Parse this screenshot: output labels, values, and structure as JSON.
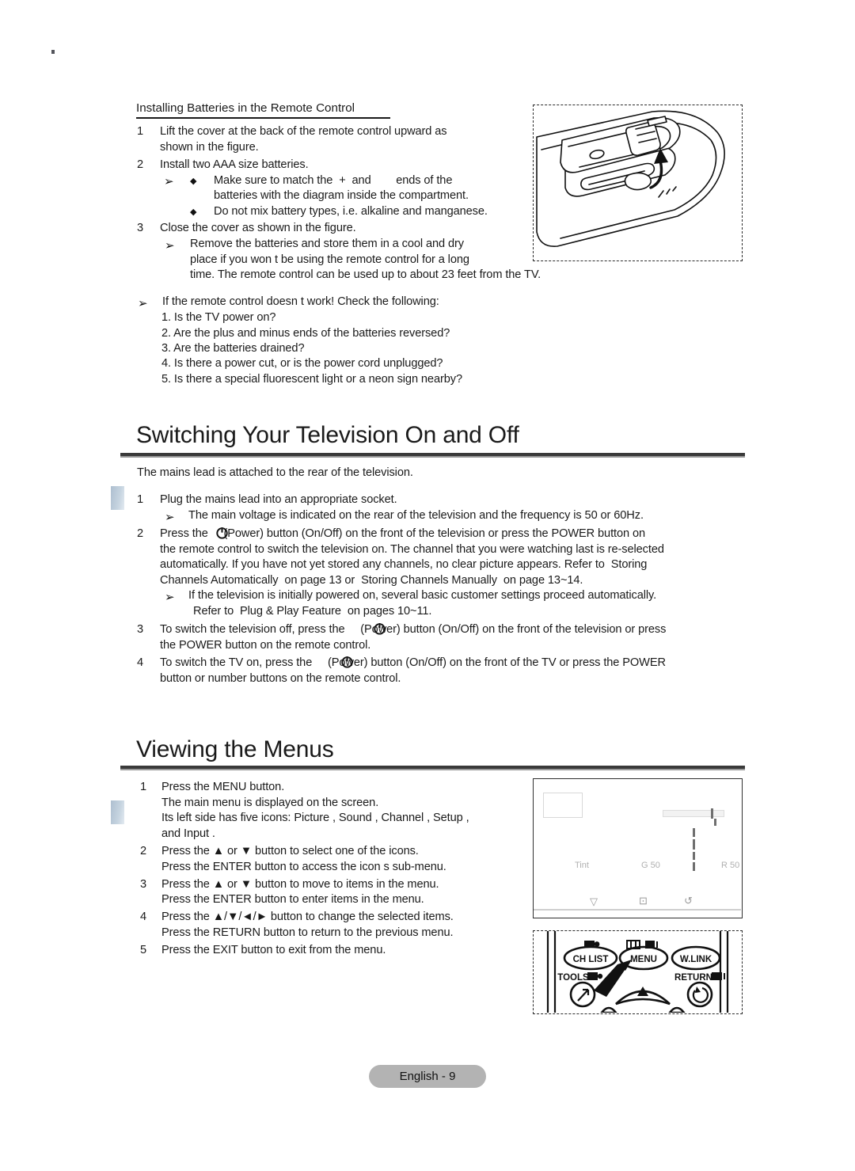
{
  "page": {
    "footer_label": "English - 9"
  },
  "battery_section": {
    "heading": "Installing Batteries in the Remote Control",
    "steps": [
      {
        "num": "1",
        "lines": [
          "Lift the cover at the back of the remote control upward as",
          "shown in the figure."
        ]
      },
      {
        "num": "2",
        "lines": [
          "Install two AAA size batteries."
        ]
      },
      {
        "num": "3",
        "lines": [
          "Close the cover as shown in the figure."
        ]
      }
    ],
    "bullet_a_line1": "Make sure to match the  +  and        ends of the",
    "bullet_a_line2": "batteries with the diagram inside the compartment.",
    "bullet_b": "Do not mix battery types, i.e. alkaline and manganese.",
    "note_lines": [
      "Remove the batteries and store them in a cool and dry",
      "place if you won t be using the remote control for a long",
      "time. The remote control can be used up to about 23 feet from the TV."
    ],
    "trouble_intro": "If the remote control doesn t work! Check the following:",
    "trouble_items": [
      "1. Is the TV power on?",
      "2. Are the plus and minus ends of the batteries reversed?",
      "3. Are the batteries drained?",
      "4. Is there a power cut, or is the power cord unplugged?",
      "5. Is there a special fluorescent light or a neon sign nearby?"
    ]
  },
  "switching_section": {
    "title": "Switching Your Television On and Off",
    "intro": "The mains lead is attached to the rear of the television.",
    "step1_num": "1",
    "step1": "Plug the mains lead into an appropriate socket.",
    "step1_note": "The main voltage is indicated on the rear of the television and the frequency is 50 or 60Hz.",
    "step2_num": "2",
    "step2_lines": [
      "Press the     (Power) button (On/Off) on the front of the television or press the POWER button on",
      "the remote control to switch the television on. The channel that you were watching last is re-selected",
      "automatically. If you have not yet stored any channels, no clear picture appears. Refer to  Storing",
      "Channels Automatically  on page 13 or  Storing Channels Manually  on page 13~14."
    ],
    "step2_note_lines": [
      "If the television is initially powered on, several basic customer settings proceed automatically.",
      "Refer to  Plug & Play Feature  on pages 10~11."
    ],
    "step3_num": "3",
    "step3_lines": [
      "To switch the television off, press the     (Power) button (On/Off) on the front of the television or press",
      "the POWER button on the remote control."
    ],
    "step4_num": "4",
    "step4_lines": [
      "To switch the TV on, press the     (Power) button (On/Off) on the front of the TV or press the POWER",
      "button or number buttons on the remote control."
    ]
  },
  "menus_section": {
    "title": "Viewing the Menus",
    "steps": [
      {
        "num": "1",
        "lines": [
          "Press the MENU button.",
          "The main menu is displayed on the screen.",
          "Its left side has five icons: Picture , Sound , Channel , Setup ,",
          "and Input ."
        ]
      },
      {
        "num": "2",
        "lines": [
          "Press the ▲ or ▼ button to select one of the icons.",
          "Press the ENTER button to access the icon s sub-menu."
        ]
      },
      {
        "num": "3",
        "lines": [
          "Press the ▲ or ▼ button to move to items in the menu.",
          "Press the ENTER button to enter items in the menu."
        ]
      },
      {
        "num": "4",
        "lines": [
          "Press the ▲/▼/◄/► button to change the selected items.",
          "Press the RETURN button to return to the previous menu."
        ]
      },
      {
        "num": "5",
        "lines": [
          "Press the EXIT button to exit from the menu."
        ]
      }
    ]
  },
  "osd_figure": {
    "label_tint": "Tint",
    "label_green": "G 50",
    "label_red": "R 50",
    "icon_move": "▽",
    "icon_enter": "⊡",
    "icon_return": "↺"
  },
  "remote_figure": {
    "buttons": [
      {
        "name": "ch-list-button",
        "label": "CH LIST"
      },
      {
        "name": "menu-button",
        "label": "MENU"
      },
      {
        "name": "w-link-button",
        "label": "W.LINK"
      }
    ],
    "tools_label": "TOOLS",
    "return_label": "RETURN"
  },
  "colors": {
    "ink": "#1a1a1a",
    "rule": "#3a3a3a",
    "footer_bg": "#b3b3b3",
    "margin_tab": "#aebfd0",
    "osd_gray": "#b0b0b0"
  }
}
